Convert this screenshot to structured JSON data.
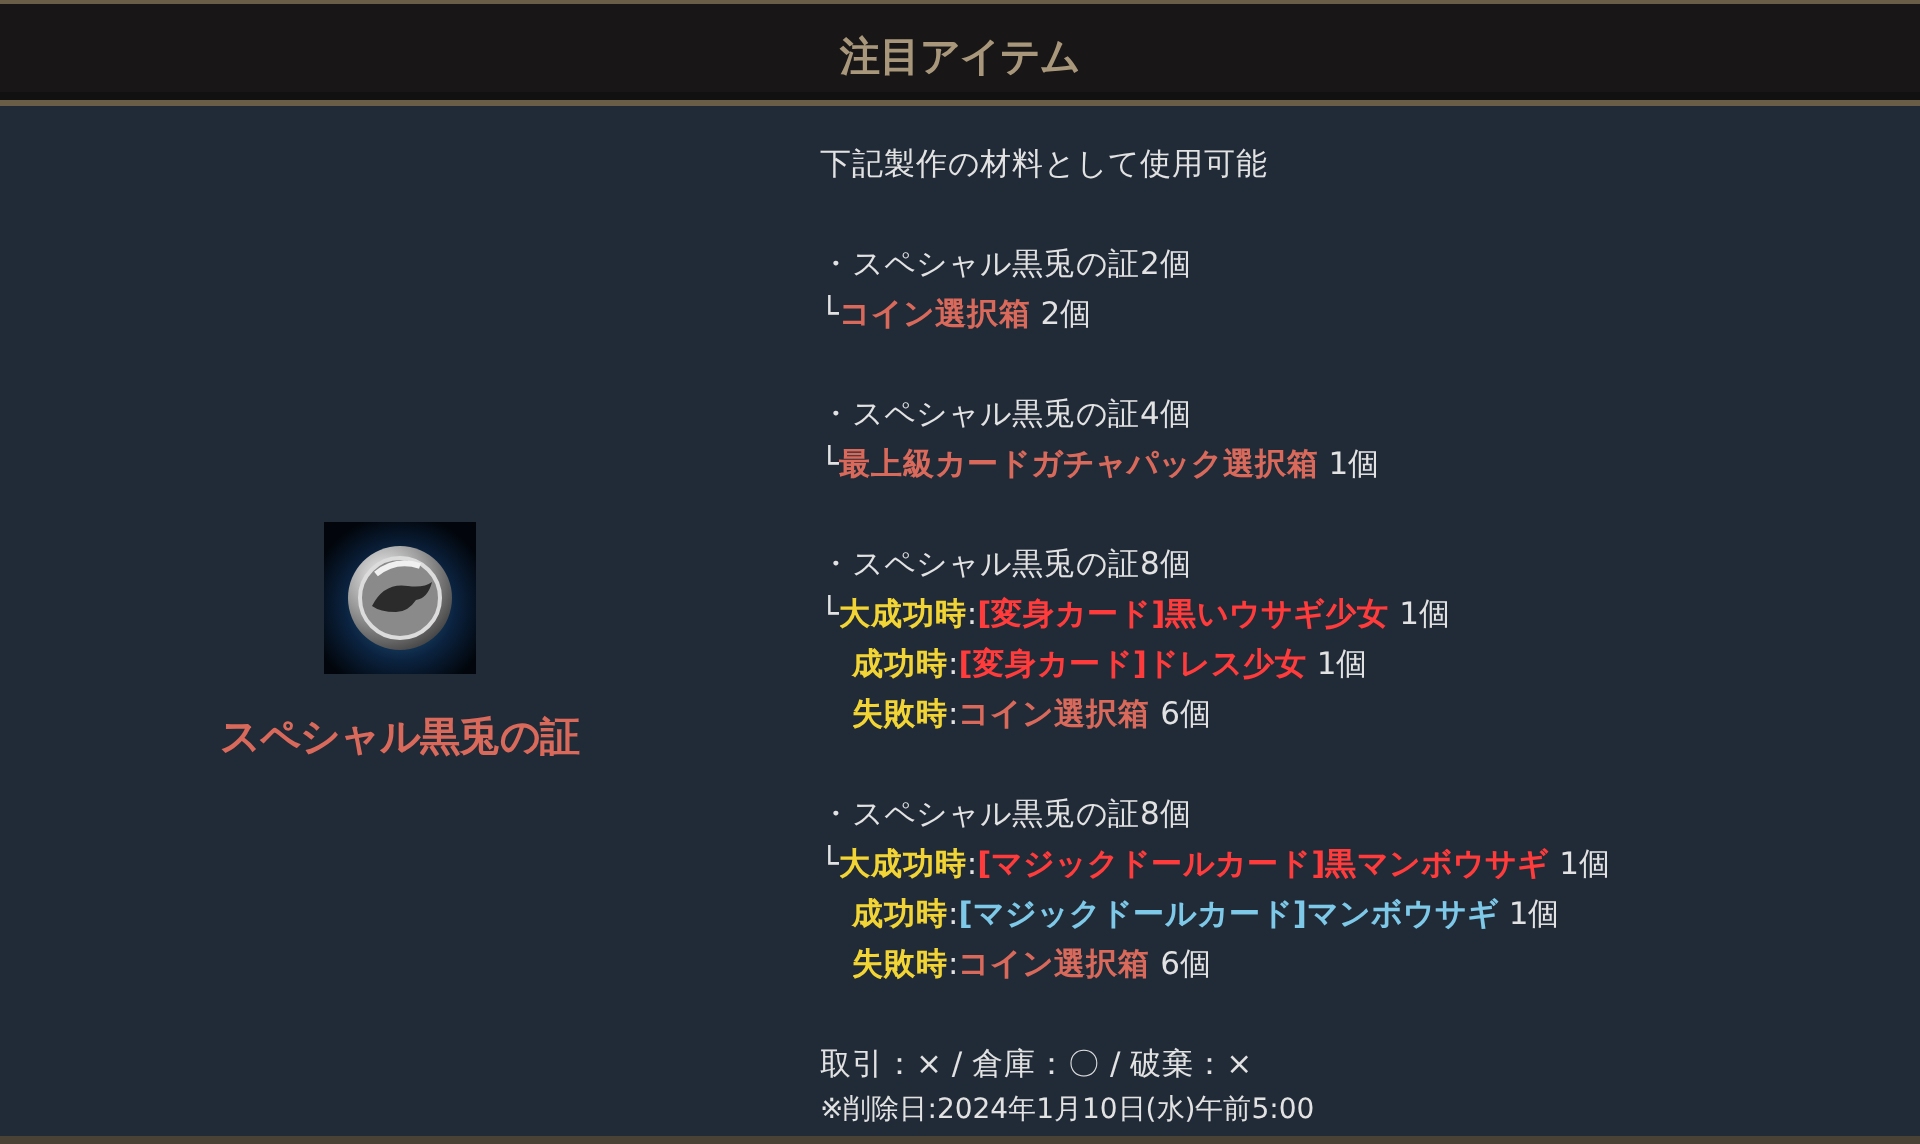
{
  "header": {
    "title": "注目アイテム"
  },
  "item": {
    "name": "スペシャル黒兎の証"
  },
  "details": {
    "intro": "下記製作の材料として使用可能",
    "recipes": [
      {
        "requirement": "・スペシャル黒兎の証2個",
        "results": [
          {
            "marker": "└",
            "segments": [
              {
                "kind": "item-common",
                "text": "コイン選択箱"
              },
              {
                "kind": "plain",
                "text": " 2個"
              }
            ]
          }
        ]
      },
      {
        "requirement": "・スペシャル黒兎の証4個",
        "results": [
          {
            "marker": "└",
            "segments": [
              {
                "kind": "item-common",
                "text": "最上級カードガチャパック選択箱"
              },
              {
                "kind": "plain",
                "text": " 1個"
              }
            ]
          }
        ]
      },
      {
        "requirement": "・スペシャル黒兎の証8個",
        "results": [
          {
            "marker": "└",
            "segments": [
              {
                "kind": "label",
                "text": "大成功時"
              },
              {
                "kind": "plain",
                "text": ":"
              },
              {
                "kind": "item-rare",
                "text": "[変身カード]黒いウサギ少女"
              },
              {
                "kind": "plain",
                "text": " 1個"
              }
            ]
          },
          {
            "segments": [
              {
                "kind": "label",
                "text": "成功時"
              },
              {
                "kind": "plain",
                "text": ":"
              },
              {
                "kind": "item-rare",
                "text": "[変身カード]ドレス少女"
              },
              {
                "kind": "plain",
                "text": " 1個"
              }
            ]
          },
          {
            "segments": [
              {
                "kind": "label",
                "text": "失敗時"
              },
              {
                "kind": "plain",
                "text": ":"
              },
              {
                "kind": "item-common",
                "text": "コイン選択箱"
              },
              {
                "kind": "plain",
                "text": " 6個"
              }
            ]
          }
        ]
      },
      {
        "requirement": "・スペシャル黒兎の証8個",
        "results": [
          {
            "marker": "└",
            "segments": [
              {
                "kind": "label",
                "text": "大成功時"
              },
              {
                "kind": "plain",
                "text": ":"
              },
              {
                "kind": "item-rare",
                "text": "[マジックドールカード]黒マンボウサギ"
              },
              {
                "kind": "plain",
                "text": " 1個"
              }
            ]
          },
          {
            "segments": [
              {
                "kind": "label",
                "text": "成功時"
              },
              {
                "kind": "plain",
                "text": ":"
              },
              {
                "kind": "item-magic",
                "text": "[マジックドールカード]マンボウサギ"
              },
              {
                "kind": "plain",
                "text": " 1個"
              }
            ]
          },
          {
            "segments": [
              {
                "kind": "label",
                "text": "失敗時"
              },
              {
                "kind": "plain",
                "text": ":"
              },
              {
                "kind": "item-common",
                "text": "コイン選択箱"
              },
              {
                "kind": "plain",
                "text": " 6個"
              }
            ]
          }
        ]
      }
    ],
    "trade_info": "取引：× / 倉庫：〇 / 破棄：×",
    "deletion_date": "※削除日:2024年1月10日(水)午前5:00"
  }
}
